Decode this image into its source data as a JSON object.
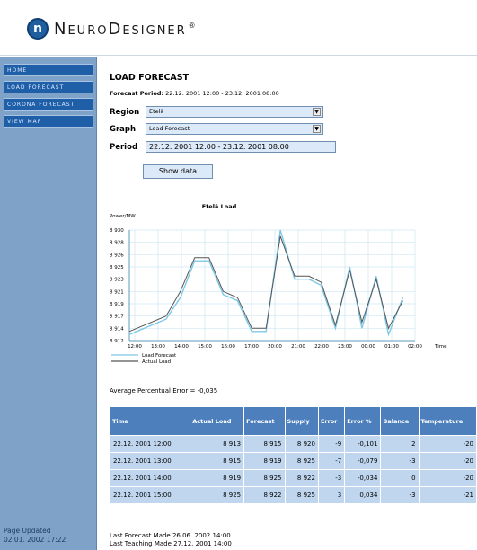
{
  "header": {
    "logo_letter": "n",
    "logo_text": "NeuroDesigner",
    "logo_reg": "®"
  },
  "sidebar": {
    "items": [
      {
        "label": "HOME"
      },
      {
        "label": "LOAD FORECAST"
      },
      {
        "label": "CORONA FORECAST"
      },
      {
        "label": "VIEW MAP"
      }
    ],
    "updated_label": "Page Updated",
    "updated_value": "02.01. 2002 17:22"
  },
  "main": {
    "title": "LOAD FORECAST",
    "forecast_period_label": "Forecast Period:",
    "forecast_period_value": "22.12. 2001 12:00 - 23.12. 2001 08:00",
    "region_label": "Region",
    "region_value": "Etelä",
    "graph_label": "Graph",
    "graph_value": "Load Forecast",
    "period_label": "Period",
    "period_value": "22.12. 2001 12:00 - 23.12. 2001 08:00",
    "show_button": "Show data",
    "avg_error": "Average Percentual Error = -0,035",
    "last_forecast": "Last Forecast Made 26.06. 2002 14:00",
    "last_teaching": "Last Teaching Made 27.12. 2001 14:00"
  },
  "chart_data": {
    "type": "line",
    "title": "Etelä Load",
    "ylabel": "Power/MW",
    "xlabel": "Time",
    "x": [
      "12:00",
      "13:00",
      "14:00",
      "15:00",
      "16:00",
      "17:00",
      "18:00",
      "19:00",
      "20:00",
      "21:00",
      "22:00",
      "23:00",
      "00:00",
      "01:00",
      "02:00"
    ],
    "x_ticks": [
      "12:00",
      "13:00",
      "14:00",
      "15:00",
      "16:00",
      "17:00",
      "20:00",
      "21:00",
      "22:00",
      "23:00",
      "00:00",
      "01:00",
      "02:00"
    ],
    "y_ticks": [
      "8 930",
      "8 928",
      "8 926",
      "8 925",
      "8 923",
      "8 921",
      "8 919",
      "8 917",
      "8 914",
      "8 912"
    ],
    "ylim": [
      8912,
      8930
    ],
    "series": [
      {
        "name": "Load Forecast",
        "color": "#7fc8e6",
        "points": [
          [
            0,
            8913
          ],
          [
            1.8,
            8915.5
          ],
          [
            2.5,
            8919
          ],
          [
            3.2,
            8925
          ],
          [
            3.9,
            8925
          ],
          [
            4.6,
            8919.5
          ],
          [
            5.3,
            8918.5
          ],
          [
            6.0,
            8913.5
          ],
          [
            6.7,
            8913.5
          ],
          [
            7.4,
            8930
          ],
          [
            8.1,
            8922
          ],
          [
            8.8,
            8922
          ],
          [
            9.4,
            8921
          ],
          [
            10.1,
            8914
          ],
          [
            10.8,
            8924
          ],
          [
            11.4,
            8914
          ],
          [
            12.1,
            8922.5
          ],
          [
            12.7,
            8913
          ],
          [
            13.4,
            8919
          ]
        ]
      },
      {
        "name": "Actual Load",
        "color": "#555555",
        "points": [
          [
            0,
            8913.5
          ],
          [
            1.8,
            8916
          ],
          [
            2.5,
            8920
          ],
          [
            3.2,
            8925.5
          ],
          [
            3.9,
            8925.5
          ],
          [
            4.6,
            8920
          ],
          [
            5.3,
            8919
          ],
          [
            6.0,
            8914
          ],
          [
            6.7,
            8914
          ],
          [
            7.4,
            8929
          ],
          [
            8.1,
            8922.5
          ],
          [
            8.8,
            8922.5
          ],
          [
            9.4,
            8921.5
          ],
          [
            10.1,
            8914.5
          ],
          [
            10.8,
            8923.5
          ],
          [
            11.4,
            8915
          ],
          [
            12.1,
            8922
          ],
          [
            12.7,
            8914
          ],
          [
            13.4,
            8918.5
          ]
        ]
      }
    ],
    "grid": true,
    "legend": "bottom-left"
  },
  "table": {
    "headers": [
      "Time",
      "Actual Load",
      "Forecast",
      "Supply",
      "Error",
      "Error %",
      "Balance",
      "Temperature"
    ],
    "rows": [
      [
        "22.12. 2001 12:00",
        "8 913",
        "8 915",
        "8 920",
        "-9",
        "-0,101",
        "2",
        "-20"
      ],
      [
        "22.12. 2001 13:00",
        "8 915",
        "8 919",
        "8 925",
        "-7",
        "-0,079",
        "-3",
        "-20"
      ],
      [
        "22.12. 2001 14:00",
        "8 919",
        "8 925",
        "8 922",
        "-3",
        "-0,034",
        "0",
        "-20"
      ],
      [
        "22.12. 2001 15:00",
        "8 925",
        "8 922",
        "8 925",
        "3",
        "0,034",
        "-3",
        "-21"
      ]
    ]
  },
  "colors": {
    "sidebar": "#7fa2c8",
    "nav": "#1e5fa8",
    "table_header": "#4c7fbc",
    "table_cell": "#bfd6ee",
    "input_bg": "#dce9f8"
  }
}
